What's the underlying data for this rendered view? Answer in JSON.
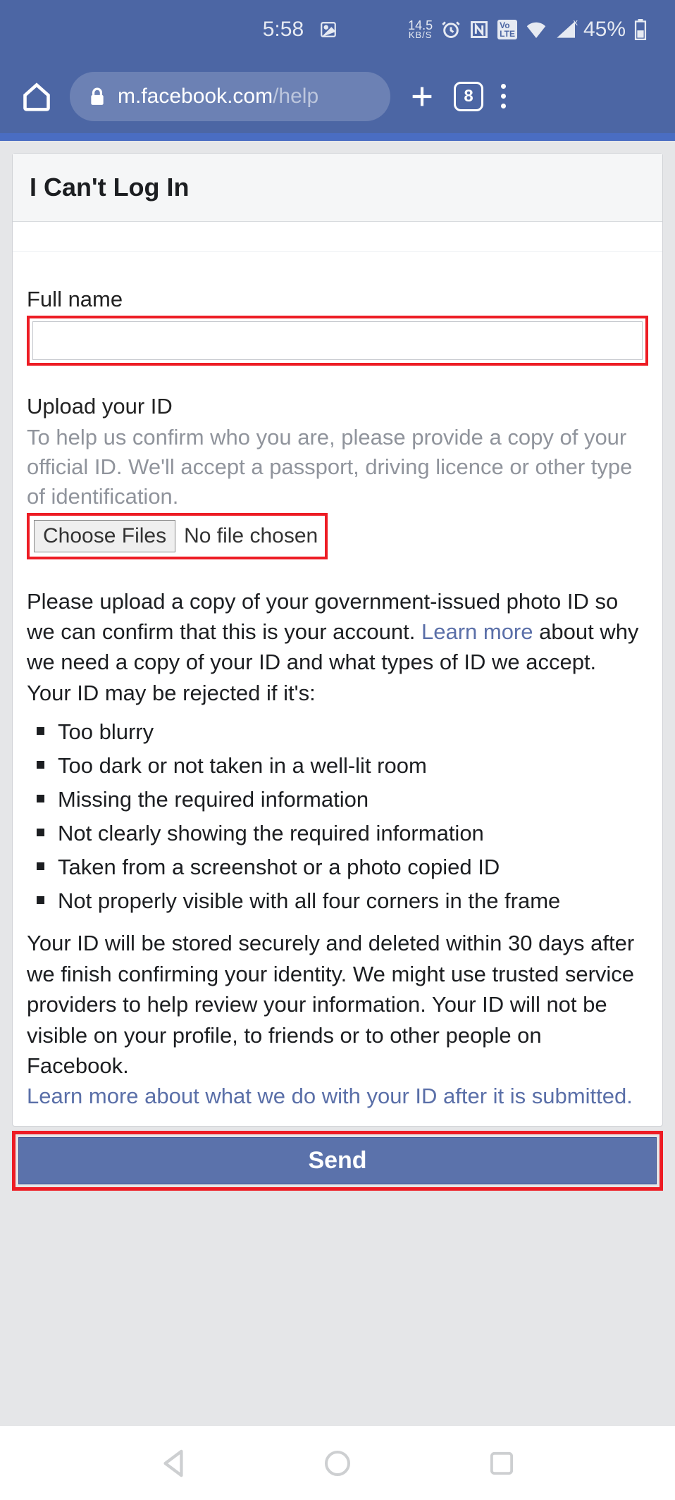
{
  "status": {
    "time": "5:58",
    "speed_value": "14.5",
    "speed_unit": "KB/S",
    "battery": "45%"
  },
  "chrome": {
    "url_main": "m.facebook.com",
    "url_path": "/help",
    "tab_count": "8"
  },
  "page": {
    "header": "I Can't Log In",
    "fullname_label": "Full name",
    "upload_label": "Upload your ID",
    "upload_helper": "To help us confirm who you are, please provide a copy of your official ID. We'll accept a passport, driving licence or other type of identification.",
    "choose_files": "Choose Files",
    "no_file": "No file chosen",
    "p1_a": "Please upload a copy of your government-issued photo ID so we can confirm that this is your account. ",
    "p1_link": "Learn more",
    "p1_b": " about why we need a copy of your ID and what types of ID we accept.",
    "p2": "Your ID may be rejected if it's:",
    "reject_list": [
      "Too blurry",
      "Too dark or not taken in a well-lit room",
      "Missing the required information",
      "Not clearly showing the required information",
      "Taken from a screenshot or a photo copied ID",
      "Not properly visible with all four corners in the frame"
    ],
    "p3": "Your ID will be stored securely and deleted within 30 days after we finish confirming your identity. We might use trusted service providers to help review your information. Your ID will not be visible on your profile, to friends or to other people on Facebook.",
    "p4_link": "Learn more about what we do with your ID after it is submitted.",
    "send": "Send"
  }
}
